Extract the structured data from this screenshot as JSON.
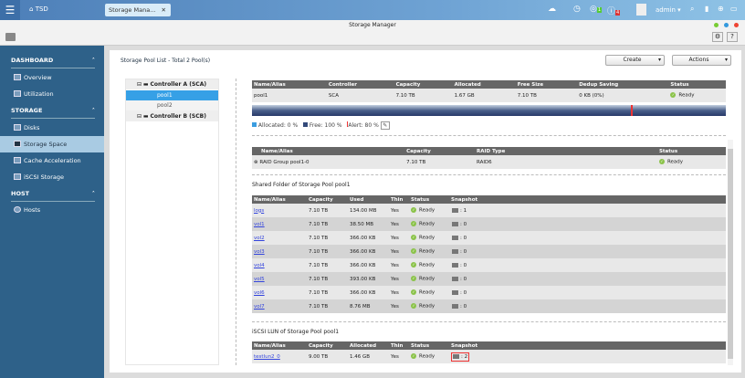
{
  "topbar": {
    "home_label": "TSD",
    "app_tab": "Storage Mana...",
    "user": "admin",
    "badge_green": "1",
    "badge_red": "4"
  },
  "window": {
    "title": "Storage Manager"
  },
  "sidebar": {
    "sections": [
      {
        "label": "DASHBOARD",
        "items": [
          "Overview",
          "Utilization"
        ]
      },
      {
        "label": "STORAGE",
        "items": [
          "Disks",
          "Storage Space",
          "Cache Acceleration",
          "iSCSI Storage"
        ]
      },
      {
        "label": "HOST",
        "items": [
          "Hosts"
        ]
      }
    ],
    "selected": "Storage Space"
  },
  "main": {
    "pool_list_title": "Storage Pool List - Total 2 Pool(s)",
    "create_label": "Create",
    "actions_label": "Actions",
    "tree": {
      "controller_a": "Controller A (SCA)",
      "pools": [
        "pool1",
        "pool2"
      ],
      "controller_b": "Controller B (SCB)"
    },
    "pool_table": {
      "headers": [
        "Name/Alias",
        "Controller",
        "Capacity",
        "Allocated",
        "Free Size",
        "Dedup Saving",
        "Status"
      ],
      "row": [
        "pool1",
        "SCA",
        "7.10 TB",
        "1.67 GB",
        "7.10 TB",
        "0 KB (0%)",
        "Ready"
      ]
    },
    "usage": {
      "allocated_pct": 0,
      "alert_pct": 80,
      "allocated_label": "Allocated: 0 %",
      "free_label": "Free: 100 %",
      "alert_label": "Alert: 80 %"
    },
    "raid_table": {
      "headers": [
        "Name/Alias",
        "Capacity",
        "RAID Type",
        "Status"
      ],
      "row": [
        "RAID Group pool1-0",
        "7.10 TB",
        "RAID6",
        "Ready"
      ]
    },
    "shared_title": "Shared Folder of Storage Pool pool1",
    "shared_table": {
      "headers": [
        "Name/Alias",
        "Capacity",
        "Used",
        "Thin",
        "Status",
        "Snapshot"
      ],
      "rows": [
        [
          "logs",
          "7.10 TB",
          "134.00 MB",
          "Yes",
          "Ready",
          ": 1"
        ],
        [
          "vol1",
          "7.10 TB",
          "38.50 MB",
          "Yes",
          "Ready",
          ": 0"
        ],
        [
          "vol2",
          "7.10 TB",
          "366.00 KB",
          "Yes",
          "Ready",
          ": 0"
        ],
        [
          "vol3",
          "7.10 TB",
          "366.00 KB",
          "Yes",
          "Ready",
          ": 0"
        ],
        [
          "vol4",
          "7.10 TB",
          "366.00 KB",
          "Yes",
          "Ready",
          ": 0"
        ],
        [
          "vol5",
          "7.10 TB",
          "393.00 KB",
          "Yes",
          "Ready",
          ": 0"
        ],
        [
          "vol6",
          "7.10 TB",
          "366.00 KB",
          "Yes",
          "Ready",
          ": 0"
        ],
        [
          "vol7",
          "7.10 TB",
          "8.76 MB",
          "Yes",
          "Ready",
          ": 0"
        ]
      ]
    },
    "iscsi_title": "iSCSI LUN of Storage Pool pool1",
    "iscsi_table": {
      "headers": [
        "Name/Alias",
        "Capacity",
        "Allocated",
        "Thin",
        "Status",
        "Snapshot"
      ],
      "rows": [
        [
          "testlun2_0",
          "9.00 TB",
          "1.46 GB",
          "Yes",
          "Ready",
          ": 2"
        ]
      ]
    }
  }
}
